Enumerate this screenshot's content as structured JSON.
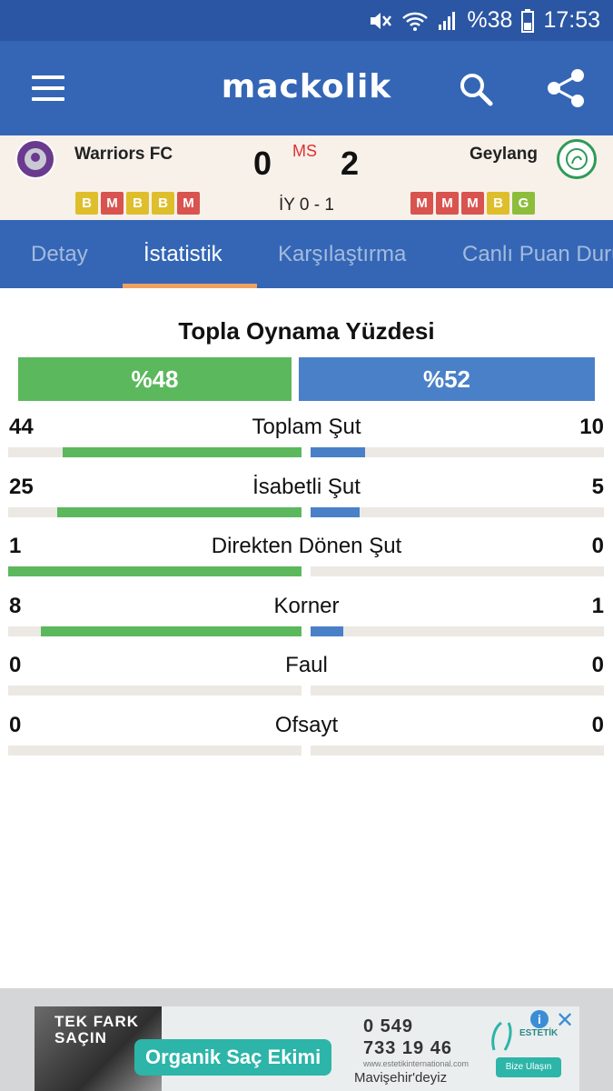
{
  "status_bar": {
    "battery": "%38",
    "time": "17:53"
  },
  "app": {
    "title": "mackolik"
  },
  "match": {
    "home_team": "Warriors FC",
    "away_team": "Geylang",
    "home_score": "0",
    "away_score": "2",
    "status": "MS",
    "half_time": "İY 0 - 1",
    "home_form": [
      "B",
      "M",
      "B",
      "B",
      "M"
    ],
    "away_form": [
      "M",
      "M",
      "M",
      "B",
      "G"
    ]
  },
  "tabs": [
    "Detay",
    "İstatistik",
    "Karşılaştırma",
    "Canlı Puan Durumu"
  ],
  "active_tab": 1,
  "possession": {
    "title": "Topla Oynama Yüzdesi",
    "home": "%48",
    "away": "%52",
    "home_pct": 48,
    "away_pct": 52
  },
  "stats": [
    {
      "label": "Toplam Şut",
      "home": "44",
      "away": "10",
      "home_val": 44,
      "away_val": 10
    },
    {
      "label": "İsabetli Şut",
      "home": "25",
      "away": "5",
      "home_val": 25,
      "away_val": 5
    },
    {
      "label": "Direkten Dönen Şut",
      "home": "1",
      "away": "0",
      "home_val": 1,
      "away_val": 0
    },
    {
      "label": "Korner",
      "home": "8",
      "away": "1",
      "home_val": 8,
      "away_val": 1
    },
    {
      "label": "Faul",
      "home": "0",
      "away": "0",
      "home_val": 0,
      "away_val": 0
    },
    {
      "label": "Ofsayt",
      "home": "0",
      "away": "0",
      "home_val": 0,
      "away_val": 0
    }
  ],
  "colors": {
    "home": "#5cb85c",
    "away": "#4a80c8",
    "win": "#dfbe2c",
    "loss": "#d9534f",
    "draw": "#8dbd3b"
  },
  "ad": {
    "headline_1": "TEK FARK",
    "headline_2": "SAÇIN",
    "pill": "Organik Saç Ekimi",
    "phone_1": "0 549",
    "phone_2": "733 19 46",
    "url": "www.estetikinternational.com",
    "address": "Mavişehir'deyiz",
    "brand": "ESTETİK",
    "cta": "Bize Ulaşın"
  }
}
